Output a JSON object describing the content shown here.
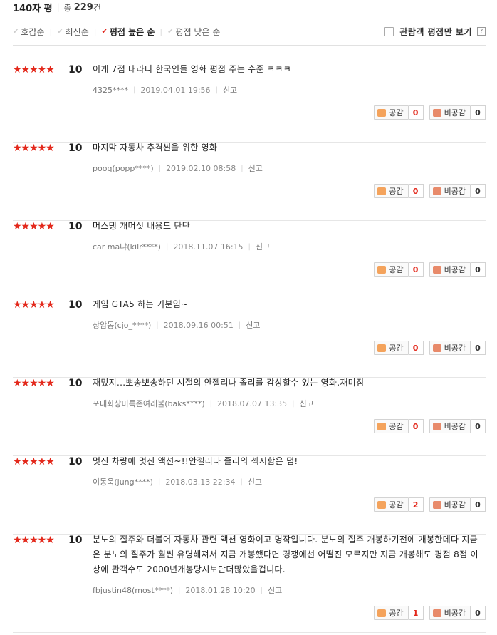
{
  "header": {
    "title": "140자 평",
    "total_label": "총",
    "total_count": "229",
    "total_unit": "건"
  },
  "sort": {
    "options": [
      "호감순",
      "최신순",
      "평점 높은 순",
      "평점 낮은 순"
    ],
    "active_index": 2,
    "viewer_only_label": "관람객 평점만 보기",
    "help_label": "?"
  },
  "vote_labels": {
    "like": "공감",
    "dislike": "비공감"
  },
  "reviews": [
    {
      "stars": "★★★★★",
      "score": "10",
      "text": "이게 7점 대라니 한국인들 영화 평점 주는 수준 ㅋㅋㅋ",
      "user": "4325****",
      "date": "2019.04.01 19:56",
      "report": "신고",
      "likes": "0",
      "dislikes": "0"
    },
    {
      "stars": "★★★★★",
      "score": "10",
      "text": "마지막 자동차 추격씬을 위한 영화",
      "user": "pooq(popp****)",
      "date": "2019.02.10 08:58",
      "report": "신고",
      "likes": "0",
      "dislikes": "0"
    },
    {
      "stars": "★★★★★",
      "score": "10",
      "text": "머스탱 개머싯 내용도 탄탄",
      "user": "car ma냐(kilr****)",
      "date": "2018.11.07 16:15",
      "report": "신고",
      "likes": "0",
      "dislikes": "0"
    },
    {
      "stars": "★★★★★",
      "score": "10",
      "text": "게임 GTA5 하는 기분임~",
      "user": "상암동(cjo_****)",
      "date": "2018.09.16 00:51",
      "report": "신고",
      "likes": "0",
      "dislikes": "0"
    },
    {
      "stars": "★★★★★",
      "score": "10",
      "text": "재밌지...뽀송뽀송하던 시절의 안젤리나 졸리를 감상할수 있는 영화.재미짐",
      "user": "포대화상미륵존여래불(baks****)",
      "date": "2018.07.07 13:35",
      "report": "신고",
      "likes": "0",
      "dislikes": "0"
    },
    {
      "stars": "★★★★★",
      "score": "10",
      "text": "멋진 차량에 멋진 액션~!!안젤리나 졸리의 섹시함은 덤!",
      "user": "이동욱(jung****)",
      "date": "2018.03.13 22:34",
      "report": "신고",
      "likes": "2",
      "dislikes": "0"
    },
    {
      "stars": "★★★★★",
      "score": "10",
      "text": "분노의 질주와 더불어 자동차 관련 액션 영화이고 명작입니다. 분노의 질주 개봉하기전에 개봉한데다 지금은 분노의 질주가 훨씬 유명해져서 지금 개봉했다면 경쟁에선 어떨진 모르지만 지금 개봉해도 평점 8점 이상에 관객수도 2000년개봉당시보단더많았을겁니다.",
      "user": "fbjustin48(most****)",
      "date": "2018.01.28 10:20",
      "report": "신고",
      "likes": "1",
      "dislikes": "0"
    }
  ]
}
